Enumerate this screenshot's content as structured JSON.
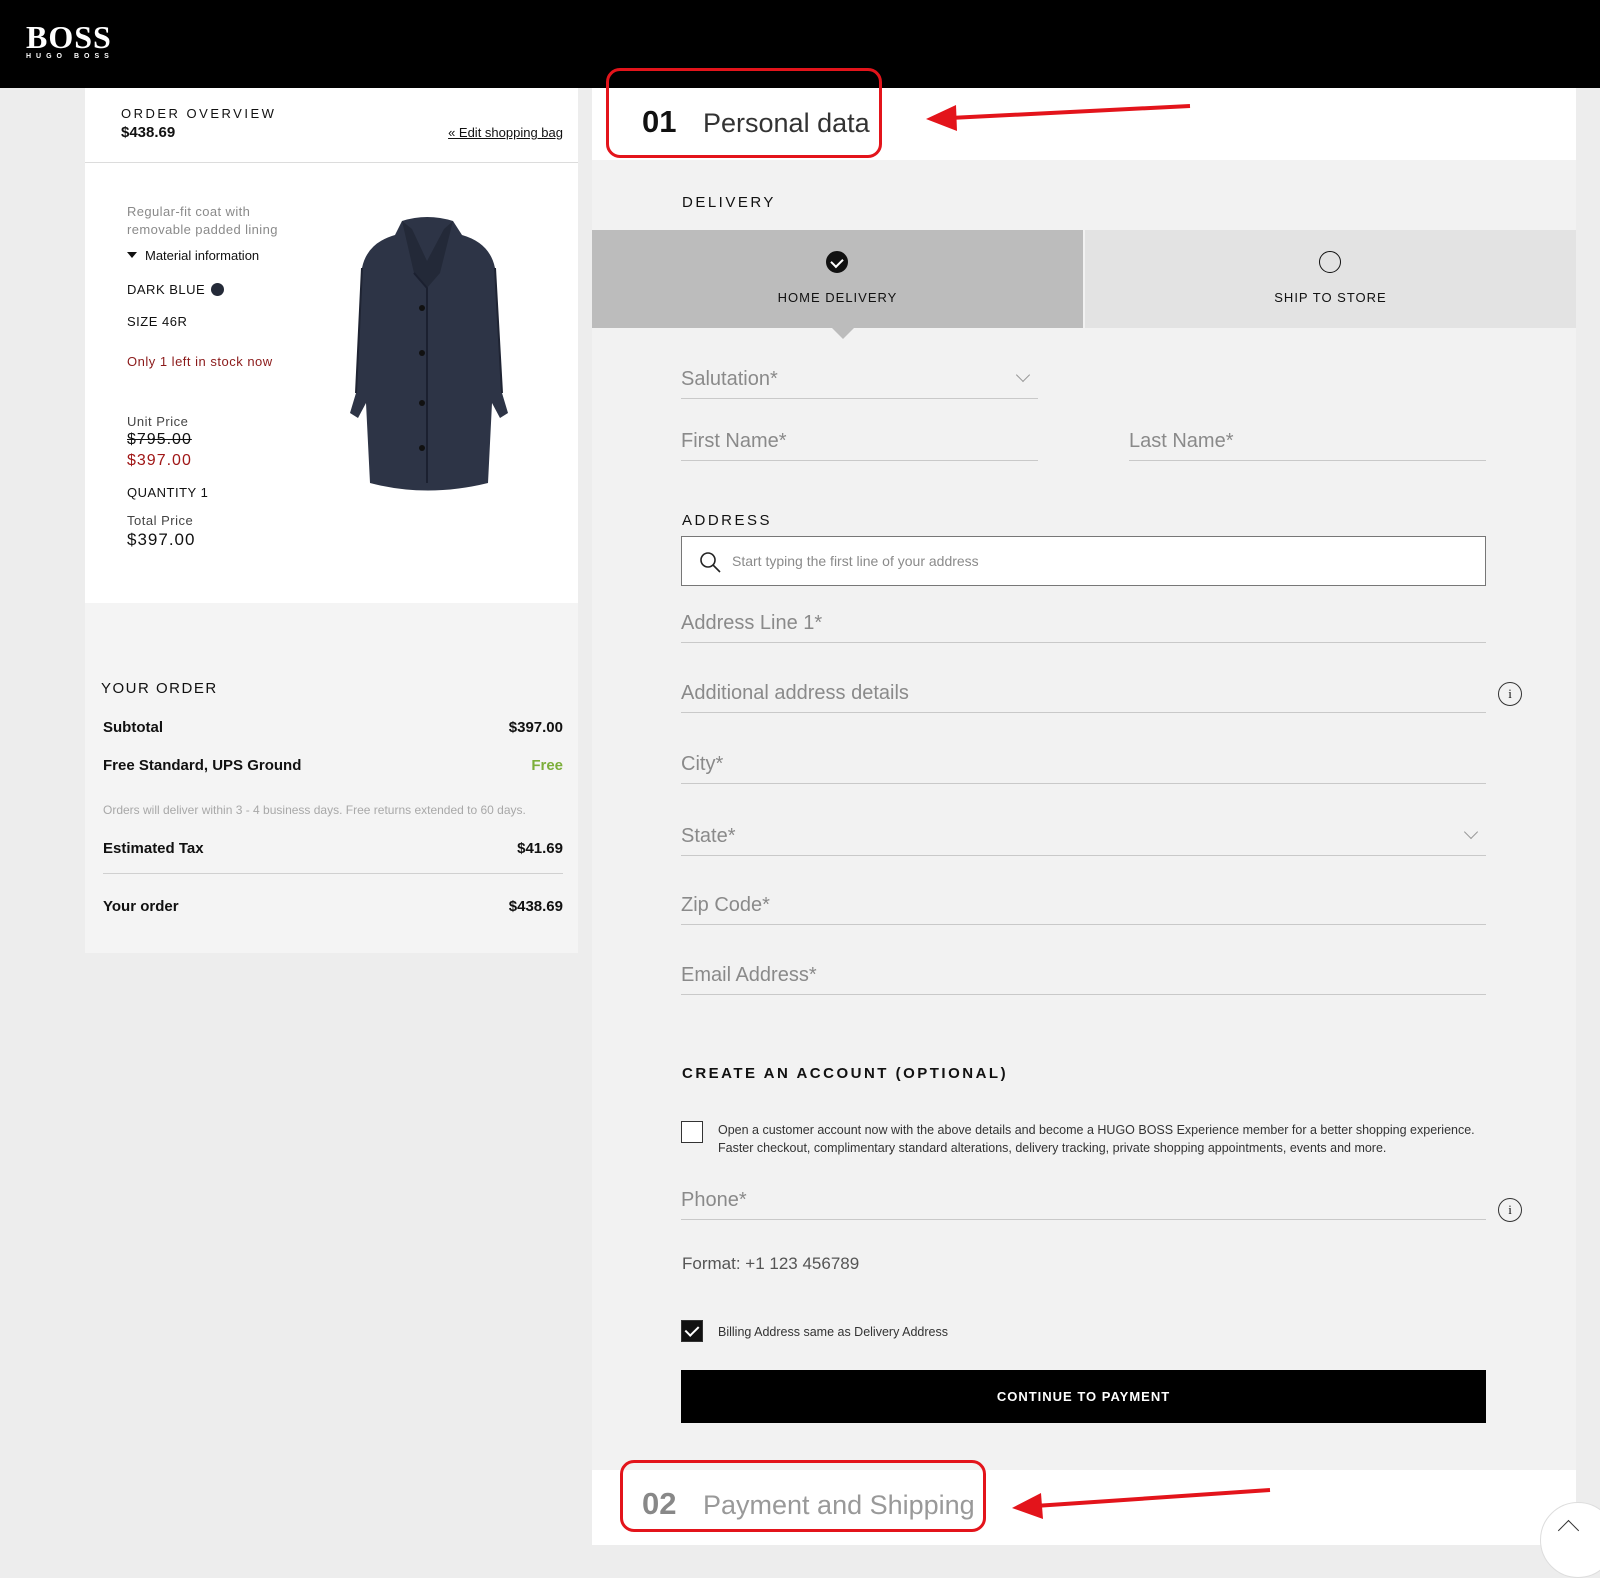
{
  "brand": {
    "logo_main": "BOSS",
    "logo_sub": "HUGO BOSS"
  },
  "overview": {
    "label": "ORDER OVERVIEW",
    "total": "$438.69",
    "edit_link": "« Edit shopping bag"
  },
  "product": {
    "description": "Regular-fit coat with removable padded lining",
    "material_toggle": "Material information",
    "color": "DARK BLUE",
    "color_hex": "#242a38",
    "size": "SIZE 46R",
    "stock": "Only 1 left in stock now",
    "unit_price_label": "Unit Price",
    "original_price": "$795.00",
    "sale_price": "$397.00",
    "quantity": "QUANTITY 1",
    "total_price_label": "Total Price",
    "total_price": "$397.00"
  },
  "summary": {
    "title": "YOUR ORDER",
    "subtotal_label": "Subtotal",
    "subtotal": "$397.00",
    "shipping_label": "Free Standard, UPS Ground",
    "shipping": "Free",
    "note": "Orders will deliver within 3 - 4 business days. Free returns extended to 60 days.",
    "tax_label": "Estimated Tax",
    "tax": "$41.69",
    "order_label": "Your order",
    "order_total": "$438.69"
  },
  "step1": {
    "number": "01",
    "title": "Personal data"
  },
  "delivery": {
    "label": "DELIVERY",
    "options": [
      {
        "label": "HOME DELIVERY",
        "selected": true
      },
      {
        "label": "SHIP TO STORE",
        "selected": false
      }
    ]
  },
  "form": {
    "salutation": "Salutation*",
    "first_name": "First Name*",
    "last_name": "Last Name*",
    "address_label": "ADDRESS",
    "address_search": "Start typing the first line of your address",
    "address_line1": "Address Line 1*",
    "address_details": "Additional address details",
    "city": "City*",
    "state": "State*",
    "zip": "Zip Code*",
    "email": "Email Address*",
    "account_label": "CREATE AN ACCOUNT (OPTIONAL)",
    "account_text": "Open a customer account now with the above details and become a HUGO BOSS Experience member for a better shopping experience. Faster checkout, complimentary standard alterations, delivery tracking, private shopping appointments, events and more.",
    "phone": "Phone*",
    "phone_format": "Format: +1 123 456789",
    "billing_same": "Billing Address same as Delivery Address",
    "continue_button": "CONTINUE TO PAYMENT",
    "info_glyph": "i"
  },
  "step2": {
    "number": "02",
    "title": "Payment and Shipping"
  },
  "colors": {
    "accent_red": "#e3141b",
    "sale_red": "#a01616",
    "free_green": "#7cae3a"
  }
}
